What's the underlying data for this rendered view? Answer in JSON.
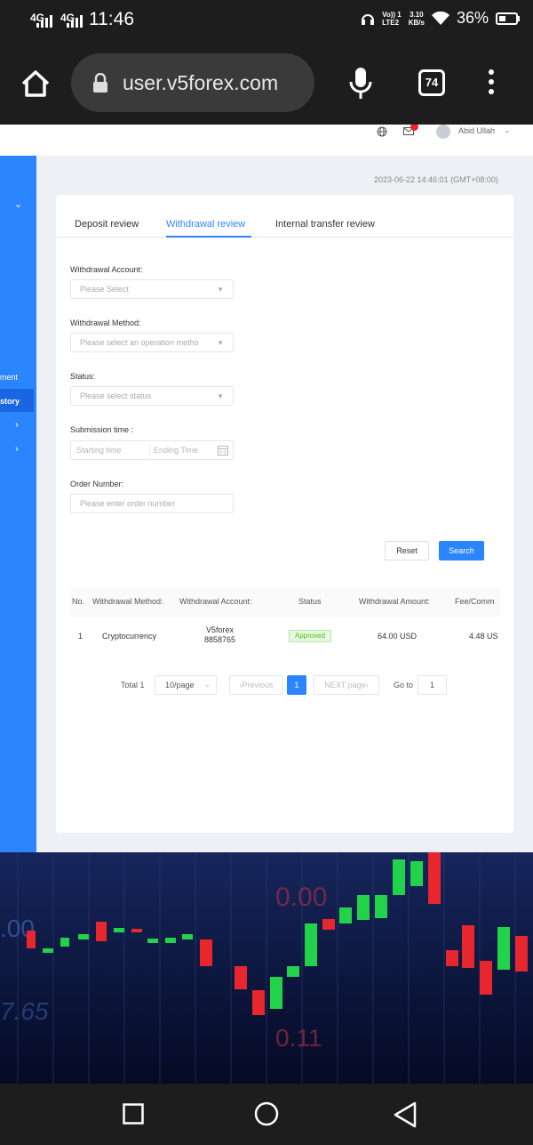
{
  "status_bar": {
    "signal_1": "4G",
    "signal_2": "4G",
    "time": "11:46",
    "net_label_1": "Vo)) 1",
    "net_label_2": "LTE2",
    "speed_value": "3.10",
    "speed_unit": "KB/s",
    "battery": "36%"
  },
  "browser": {
    "url": "user.v5forex.com",
    "tab_count": "74"
  },
  "header": {
    "user_name": "Abid Ullah"
  },
  "sidebar": {
    "items": [
      {
        "label": "ment"
      },
      {
        "label": "story"
      }
    ]
  },
  "timestamp": "2023-06-22 14:46:01 (GMT+08:00)",
  "tabs": [
    {
      "label": "Deposit review"
    },
    {
      "label": "Withdrawal review"
    },
    {
      "label": "Internal transfer review"
    }
  ],
  "form": {
    "withdrawal_account": {
      "label": "Withdrawal Account:",
      "placeholder": "Please Select"
    },
    "withdrawal_method": {
      "label": "Withdrawal Method:",
      "placeholder": "Please select an operation metho"
    },
    "status": {
      "label": "Status:",
      "placeholder": "Please select status"
    },
    "submission_time": {
      "label": "Submission time :",
      "start_placeholder": "Starting time",
      "end_placeholder": "Ending Time"
    },
    "order_number": {
      "label": "Order Number:",
      "placeholder": "Please enter order number"
    },
    "reset_label": "Reset",
    "search_label": "Search"
  },
  "table": {
    "columns": [
      "No.",
      "Withdrawal Method:",
      "Withdrawal Account:",
      "Status",
      "Withdrawal Amount:",
      "Fee/Comm"
    ],
    "rows": [
      {
        "no": "1",
        "method": "Cryptocurrency",
        "account_1": "V5forex",
        "account_2": "8858765",
        "status": "Approved",
        "amount": "64.00 USD",
        "fee": "4.48 US"
      }
    ]
  },
  "pagination": {
    "total": "Total 1",
    "page_size": "10/page",
    "previous": "Previous",
    "current_page": "1",
    "next": "NEXT page",
    "goto_label": "Go to",
    "goto_value": "1"
  },
  "background_numbers": [
    "0.00",
    ".00",
    "7.65",
    "0.11"
  ],
  "colors": {
    "accent": "#2b85ff",
    "approved": "#52c41a",
    "candle_up": "#22d24a",
    "candle_down": "#e8262e"
  }
}
